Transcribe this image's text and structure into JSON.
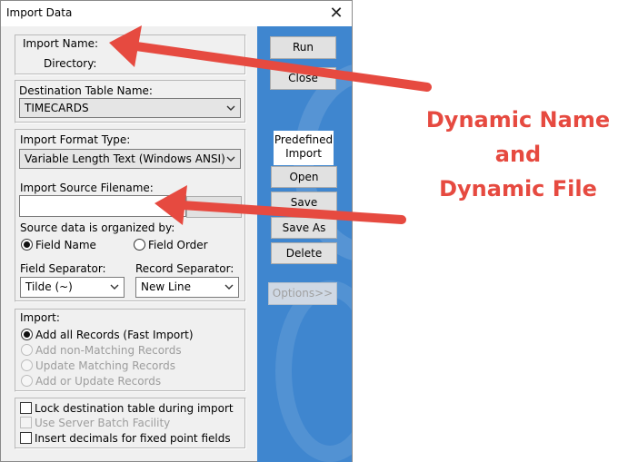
{
  "window": {
    "title": "Import Data",
    "close_glyph": "✕"
  },
  "import_info": {
    "name_label": "Import Name:",
    "directory_label": "Directory:"
  },
  "destination": {
    "label": "Destination Table Name:",
    "value": "TIMECARDS"
  },
  "format": {
    "label": "Import Format Type:",
    "value": "Variable Length Text (Windows ANSI)"
  },
  "source": {
    "filename_label": "Import Source Filename:",
    "filename_value": "",
    "browse_label": "Browse"
  },
  "organized": {
    "label": "Source data is organized by:",
    "options": [
      {
        "label": "Field Name",
        "checked": true
      },
      {
        "label": "Field Order",
        "checked": false
      }
    ]
  },
  "separators": {
    "field_label": "Field Separator:",
    "field_value": "Tilde (~)",
    "record_label": "Record Separator:",
    "record_value": "New Line"
  },
  "import_mode": {
    "label": "Import:",
    "options": [
      {
        "label": "Add all Records (Fast Import)",
        "checked": true,
        "enabled": true
      },
      {
        "label": "Add non-Matching Records",
        "checked": false,
        "enabled": false
      },
      {
        "label": "Update Matching Records",
        "checked": false,
        "enabled": false
      },
      {
        "label": "Add or Update Records",
        "checked": false,
        "enabled": false
      }
    ]
  },
  "checkboxes": [
    {
      "label": "Lock destination table during import",
      "checked": false,
      "enabled": true
    },
    {
      "label": "Use Server Batch Facility",
      "checked": false,
      "enabled": false
    },
    {
      "label": "Insert decimals for fixed point fields",
      "checked": false,
      "enabled": true
    }
  ],
  "buttons": {
    "run": "Run",
    "close": "Close",
    "predefined_line1": "Predefined",
    "predefined_line2": "Import",
    "open": "Open",
    "save": "Save",
    "save_as": "Save As",
    "delete": "Delete",
    "options": "Options>>"
  },
  "annotation": {
    "line1": "Dynamic Name",
    "line2": "and",
    "line3": "Dynamic File"
  },
  "colors": {
    "annotation": "#e64a40",
    "panel_blue": "#3f86cf"
  }
}
